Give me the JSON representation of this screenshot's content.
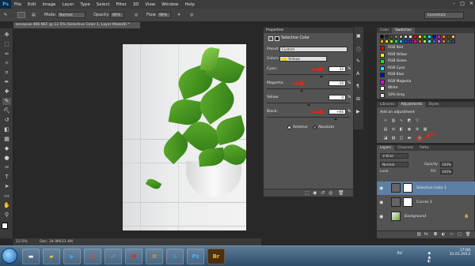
{
  "app": {
    "logo": "Ps"
  },
  "menu": [
    "File",
    "Edit",
    "Image",
    "Layer",
    "Type",
    "Select",
    "Filter",
    "3D",
    "View",
    "Window",
    "Help"
  ],
  "options": {
    "mode_label": "Mode:",
    "mode_value": "Normal",
    "opacity_label": "Opacity:",
    "opacity_value": "89%",
    "flow_label": "Flow:",
    "flow_value": "99%",
    "workspace": "Essentials"
  },
  "document": {
    "tab": "вечерни 466.NEF @ 12.5% (Selective Color 1, Layer Mask/8) *",
    "status_zoom": "12.5%",
    "status_doc": "Doc: 34.9M/33.4M"
  },
  "properties": {
    "panel_tab": "Properties",
    "title": "Selective Color",
    "preset_label": "Preset:",
    "preset_value": "Custom",
    "colors_label": "Colors:",
    "colors_value": "Yellows",
    "sliders": [
      {
        "label": "Cyan:",
        "value": "32",
        "unit": "%",
        "level": 0.66
      },
      {
        "label": "Magenta:",
        "value": "-16",
        "unit": "%",
        "level": 0.42
      },
      {
        "label": "Yellow:",
        "value": "0",
        "unit": "%",
        "level": 0.5
      },
      {
        "label": "Black:",
        "value": "+66",
        "unit": "%",
        "level": 0.83
      }
    ],
    "relative": "Relative",
    "absolute": "Absolute"
  },
  "swatches": {
    "tabs": [
      "Color",
      "Swatches"
    ],
    "items": [
      {
        "name": "RGB Red",
        "color": "#ff0000"
      },
      {
        "name": "RGB Yellow",
        "color": "#ffff00"
      },
      {
        "name": "RGB Green",
        "color": "#00ff00"
      },
      {
        "name": "RGB Cyan",
        "color": "#00ffff"
      },
      {
        "name": "RGB Blue",
        "color": "#0000ff"
      },
      {
        "name": "RGB Magenta",
        "color": "#ff00ff"
      },
      {
        "name": "White",
        "color": "#ffffff"
      },
      {
        "name": "10% Gray",
        "color": "#e6e6e6"
      }
    ],
    "row1": [
      "#000000",
      "#2b2b2b",
      "#555",
      "#808080",
      "#aaa",
      "#d4d4d4",
      "#fff",
      "#ff0000",
      "#ffff00",
      "#00ff00",
      "#00ffff",
      "#0000ff",
      "#ff00ff",
      "#ff8000",
      "#804000",
      "#ffc080"
    ],
    "row2": [
      "#ffaa00",
      "#ffe600",
      "#b4ff00",
      "#00ff78",
      "#00d2ff",
      "#0050ff",
      "#7800ff",
      "#ff00a0",
      "#ff5050",
      "#a0ff50",
      "#50ffff",
      "#5050ff",
      "#ff50ff",
      "#c08040",
      "#408040",
      "#404080"
    ]
  },
  "adjustments": {
    "tabs": [
      "Libraries",
      "Adjustments",
      "Styles"
    ],
    "add_label": "Add an adjustment"
  },
  "layers": {
    "tabs": [
      "Layers",
      "Channels",
      "Paths"
    ],
    "kind": "Kind",
    "blend": "Normal",
    "opacity_label": "Opacity:",
    "opacity_value": "100%",
    "lock_label": "Lock:",
    "fill_label": "Fill:",
    "fill_value": "100%",
    "rows": [
      {
        "name": "Selective Color 1"
      },
      {
        "name": "Curves 1"
      },
      {
        "name": "Background"
      }
    ]
  },
  "taskbar": {
    "lang": "RU",
    "time": "17:00",
    "date": "31.01.2013",
    "apps": [
      "Ps",
      "Br"
    ]
  },
  "colors": {
    "accent": "#5d7fa6",
    "arrow": "#d62a1c",
    "taskbar": "#2e4d6a"
  }
}
